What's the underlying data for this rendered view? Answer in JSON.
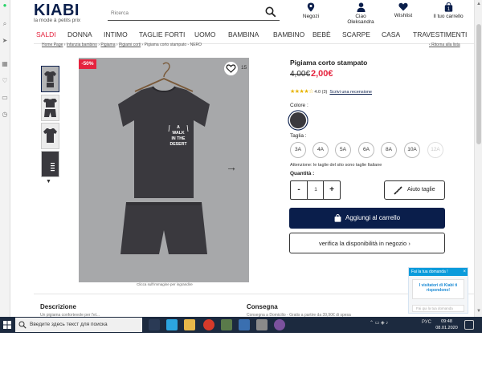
{
  "header": {
    "brand": "KIABI",
    "slogan": "la mode à petits prix",
    "search_placeholder": "Ricerca",
    "stores_label": "Negozi",
    "account_greeting": "Ciao",
    "account_name": "Oleksandra",
    "wishlist_label": "Wishlist",
    "cart_label": "Il tuo carrello",
    "cart_count": "1"
  },
  "nav": [
    "SALDI",
    "DONNA",
    "INTIMO",
    "TAGLIE FORTI",
    "UOMO",
    "BAMBINA",
    "BAMBINO",
    "BEBÈ",
    "SCARPE",
    "CASA",
    "TRAVESTIMENTI"
  ],
  "breadcrumb": {
    "items": [
      "Home Page",
      "Infanzia bambino",
      "Pigiama",
      "Pigiami corti"
    ],
    "current": "Pigiama corto stampato - NERO",
    "back": "Ritorna alla lista"
  },
  "gallery": {
    "discount_badge": "-50%",
    "fav_count": "15",
    "zoom_hint": "Clicca sull'immagine per ingrandire",
    "shirt_print": "A WALK IN THE DESERT"
  },
  "product": {
    "title": "Pigiama corto stampato",
    "old_price": "4,00€",
    "new_price": "2,00€",
    "rating_value": "4.0",
    "rating_count": "(3)",
    "review_link": "Scrivi una recensione",
    "color_label": "Colore :",
    "color_hex": "#3a393e",
    "size_label": "Taglia :",
    "sizes": [
      "3A",
      "4A",
      "5A",
      "6A",
      "8A",
      "10A",
      "12A"
    ],
    "size_note": "Attenzione: le taglie del sito sono taglie Italiane",
    "qty_label": "Quantità :",
    "qty_minus": "-",
    "qty_value": "1",
    "qty_plus": "+",
    "size_help": "Aiuto taglie",
    "add_to_cart": "Aggiungi al carrello",
    "store_check": "verifica la disponibilità in negozio ›"
  },
  "bottom": {
    "description_title": "Descrizione",
    "description_text": "Un pigiama confortevole per l'el...",
    "delivery_title": "Consegna",
    "delivery_text": "Consegna a Domicilio - Gratis a partire da 39,90€ di spesa"
  },
  "chat": {
    "header": "Fai la tua domanda !",
    "bubble": "I visitatori di Kiabi ti rispondono!",
    "input_placeholder": "Fai qui la tua domanda"
  },
  "taskbar": {
    "search_placeholder": "Введите здесь текст для поиска",
    "lang": "РУС",
    "time": "09:48",
    "date": "08.01.2020"
  },
  "colors": {
    "brand_navy": "#0a1e4b",
    "sale_red": "#e5233e",
    "chat_blue": "#0a9bdb",
    "taskbar": "#1c2a3f"
  }
}
